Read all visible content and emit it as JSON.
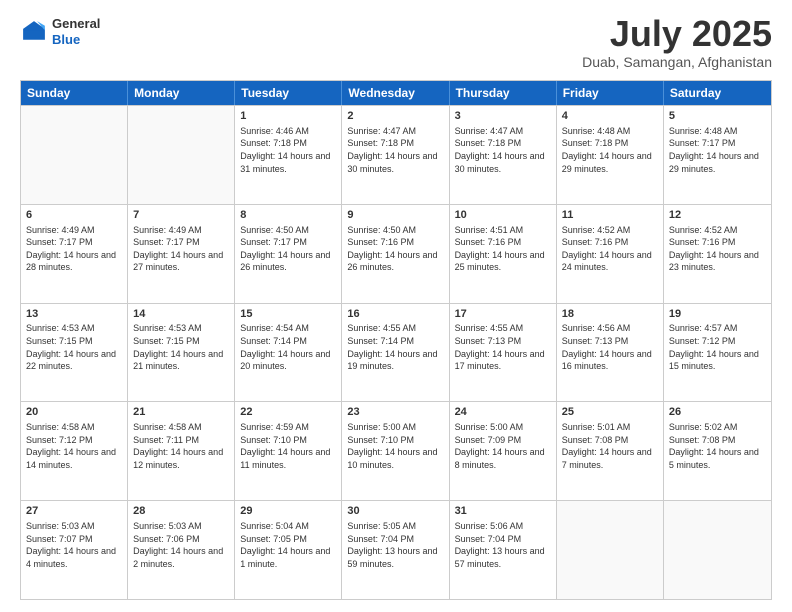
{
  "header": {
    "logo": {
      "general": "General",
      "blue": "Blue"
    },
    "title": "July 2025",
    "subtitle": "Duab, Samangan, Afghanistan"
  },
  "days": [
    "Sunday",
    "Monday",
    "Tuesday",
    "Wednesday",
    "Thursday",
    "Friday",
    "Saturday"
  ],
  "rows": [
    [
      {
        "day": "",
        "empty": true
      },
      {
        "day": "",
        "empty": true
      },
      {
        "day": "1",
        "sunrise": "Sunrise: 4:46 AM",
        "sunset": "Sunset: 7:18 PM",
        "daylight": "Daylight: 14 hours and 31 minutes."
      },
      {
        "day": "2",
        "sunrise": "Sunrise: 4:47 AM",
        "sunset": "Sunset: 7:18 PM",
        "daylight": "Daylight: 14 hours and 30 minutes."
      },
      {
        "day": "3",
        "sunrise": "Sunrise: 4:47 AM",
        "sunset": "Sunset: 7:18 PM",
        "daylight": "Daylight: 14 hours and 30 minutes."
      },
      {
        "day": "4",
        "sunrise": "Sunrise: 4:48 AM",
        "sunset": "Sunset: 7:18 PM",
        "daylight": "Daylight: 14 hours and 29 minutes."
      },
      {
        "day": "5",
        "sunrise": "Sunrise: 4:48 AM",
        "sunset": "Sunset: 7:17 PM",
        "daylight": "Daylight: 14 hours and 29 minutes."
      }
    ],
    [
      {
        "day": "6",
        "sunrise": "Sunrise: 4:49 AM",
        "sunset": "Sunset: 7:17 PM",
        "daylight": "Daylight: 14 hours and 28 minutes."
      },
      {
        "day": "7",
        "sunrise": "Sunrise: 4:49 AM",
        "sunset": "Sunset: 7:17 PM",
        "daylight": "Daylight: 14 hours and 27 minutes."
      },
      {
        "day": "8",
        "sunrise": "Sunrise: 4:50 AM",
        "sunset": "Sunset: 7:17 PM",
        "daylight": "Daylight: 14 hours and 26 minutes."
      },
      {
        "day": "9",
        "sunrise": "Sunrise: 4:50 AM",
        "sunset": "Sunset: 7:16 PM",
        "daylight": "Daylight: 14 hours and 26 minutes."
      },
      {
        "day": "10",
        "sunrise": "Sunrise: 4:51 AM",
        "sunset": "Sunset: 7:16 PM",
        "daylight": "Daylight: 14 hours and 25 minutes."
      },
      {
        "day": "11",
        "sunrise": "Sunrise: 4:52 AM",
        "sunset": "Sunset: 7:16 PM",
        "daylight": "Daylight: 14 hours and 24 minutes."
      },
      {
        "day": "12",
        "sunrise": "Sunrise: 4:52 AM",
        "sunset": "Sunset: 7:16 PM",
        "daylight": "Daylight: 14 hours and 23 minutes."
      }
    ],
    [
      {
        "day": "13",
        "sunrise": "Sunrise: 4:53 AM",
        "sunset": "Sunset: 7:15 PM",
        "daylight": "Daylight: 14 hours and 22 minutes."
      },
      {
        "day": "14",
        "sunrise": "Sunrise: 4:53 AM",
        "sunset": "Sunset: 7:15 PM",
        "daylight": "Daylight: 14 hours and 21 minutes."
      },
      {
        "day": "15",
        "sunrise": "Sunrise: 4:54 AM",
        "sunset": "Sunset: 7:14 PM",
        "daylight": "Daylight: 14 hours and 20 minutes."
      },
      {
        "day": "16",
        "sunrise": "Sunrise: 4:55 AM",
        "sunset": "Sunset: 7:14 PM",
        "daylight": "Daylight: 14 hours and 19 minutes."
      },
      {
        "day": "17",
        "sunrise": "Sunrise: 4:55 AM",
        "sunset": "Sunset: 7:13 PM",
        "daylight": "Daylight: 14 hours and 17 minutes."
      },
      {
        "day": "18",
        "sunrise": "Sunrise: 4:56 AM",
        "sunset": "Sunset: 7:13 PM",
        "daylight": "Daylight: 14 hours and 16 minutes."
      },
      {
        "day": "19",
        "sunrise": "Sunrise: 4:57 AM",
        "sunset": "Sunset: 7:12 PM",
        "daylight": "Daylight: 14 hours and 15 minutes."
      }
    ],
    [
      {
        "day": "20",
        "sunrise": "Sunrise: 4:58 AM",
        "sunset": "Sunset: 7:12 PM",
        "daylight": "Daylight: 14 hours and 14 minutes."
      },
      {
        "day": "21",
        "sunrise": "Sunrise: 4:58 AM",
        "sunset": "Sunset: 7:11 PM",
        "daylight": "Daylight: 14 hours and 12 minutes."
      },
      {
        "day": "22",
        "sunrise": "Sunrise: 4:59 AM",
        "sunset": "Sunset: 7:10 PM",
        "daylight": "Daylight: 14 hours and 11 minutes."
      },
      {
        "day": "23",
        "sunrise": "Sunrise: 5:00 AM",
        "sunset": "Sunset: 7:10 PM",
        "daylight": "Daylight: 14 hours and 10 minutes."
      },
      {
        "day": "24",
        "sunrise": "Sunrise: 5:00 AM",
        "sunset": "Sunset: 7:09 PM",
        "daylight": "Daylight: 14 hours and 8 minutes."
      },
      {
        "day": "25",
        "sunrise": "Sunrise: 5:01 AM",
        "sunset": "Sunset: 7:08 PM",
        "daylight": "Daylight: 14 hours and 7 minutes."
      },
      {
        "day": "26",
        "sunrise": "Sunrise: 5:02 AM",
        "sunset": "Sunset: 7:08 PM",
        "daylight": "Daylight: 14 hours and 5 minutes."
      }
    ],
    [
      {
        "day": "27",
        "sunrise": "Sunrise: 5:03 AM",
        "sunset": "Sunset: 7:07 PM",
        "daylight": "Daylight: 14 hours and 4 minutes."
      },
      {
        "day": "28",
        "sunrise": "Sunrise: 5:03 AM",
        "sunset": "Sunset: 7:06 PM",
        "daylight": "Daylight: 14 hours and 2 minutes."
      },
      {
        "day": "29",
        "sunrise": "Sunrise: 5:04 AM",
        "sunset": "Sunset: 7:05 PM",
        "daylight": "Daylight: 14 hours and 1 minute."
      },
      {
        "day": "30",
        "sunrise": "Sunrise: 5:05 AM",
        "sunset": "Sunset: 7:04 PM",
        "daylight": "Daylight: 13 hours and 59 minutes."
      },
      {
        "day": "31",
        "sunrise": "Sunrise: 5:06 AM",
        "sunset": "Sunset: 7:04 PM",
        "daylight": "Daylight: 13 hours and 57 minutes."
      },
      {
        "day": "",
        "empty": true
      },
      {
        "day": "",
        "empty": true
      }
    ]
  ]
}
